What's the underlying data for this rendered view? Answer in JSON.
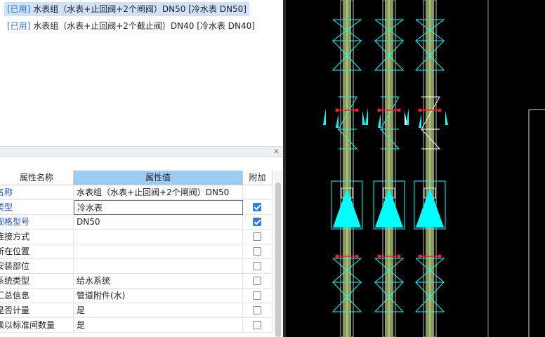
{
  "list": {
    "items": [
      {
        "tag": "[已用]",
        "text": " 水表组（水表+止回阀+2个闸阀）DN50 [冷水表 DN50]",
        "selected": true
      },
      {
        "tag": "[已用]",
        "text": " 水表组（水表+止回阀+2个截止阀）DN40 [冷水表 DN40]",
        "selected": false
      }
    ]
  },
  "panel": {
    "close_icon": "×"
  },
  "grid": {
    "headers": [
      "属性名称",
      "属性值",
      "附加"
    ],
    "rows": [
      {
        "name": "名称",
        "value": "水表组（水表+止回阀+2个闸阀）DN50",
        "checked": null,
        "link": true
      },
      {
        "name": "类型",
        "value": "冷水表",
        "checked": true,
        "link": true,
        "editing": true
      },
      {
        "name": "规格型号",
        "value": "DN50",
        "checked": true,
        "link": true
      },
      {
        "name": "连接方式",
        "value": "",
        "checked": false,
        "link": false
      },
      {
        "name": "所在位置",
        "value": "",
        "checked": false,
        "link": false
      },
      {
        "name": "安装部位",
        "value": "",
        "checked": false,
        "link": false
      },
      {
        "name": "系统类型",
        "value": "给水系统",
        "checked": false,
        "link": false
      },
      {
        "name": "汇总信息",
        "value": "管道附件(水)",
        "checked": false,
        "link": false
      },
      {
        "name": "是否计量",
        "value": "是",
        "checked": false,
        "link": false
      },
      {
        "name": "乘以标准间数量",
        "value": "是",
        "checked": false,
        "link": false
      }
    ]
  },
  "colors": {
    "cad_bg": "#000000",
    "cyan": "#00ffff",
    "pipe_green": "#8a9a5b",
    "red": "#ff2020",
    "header_blue": "#9ccbf3"
  }
}
